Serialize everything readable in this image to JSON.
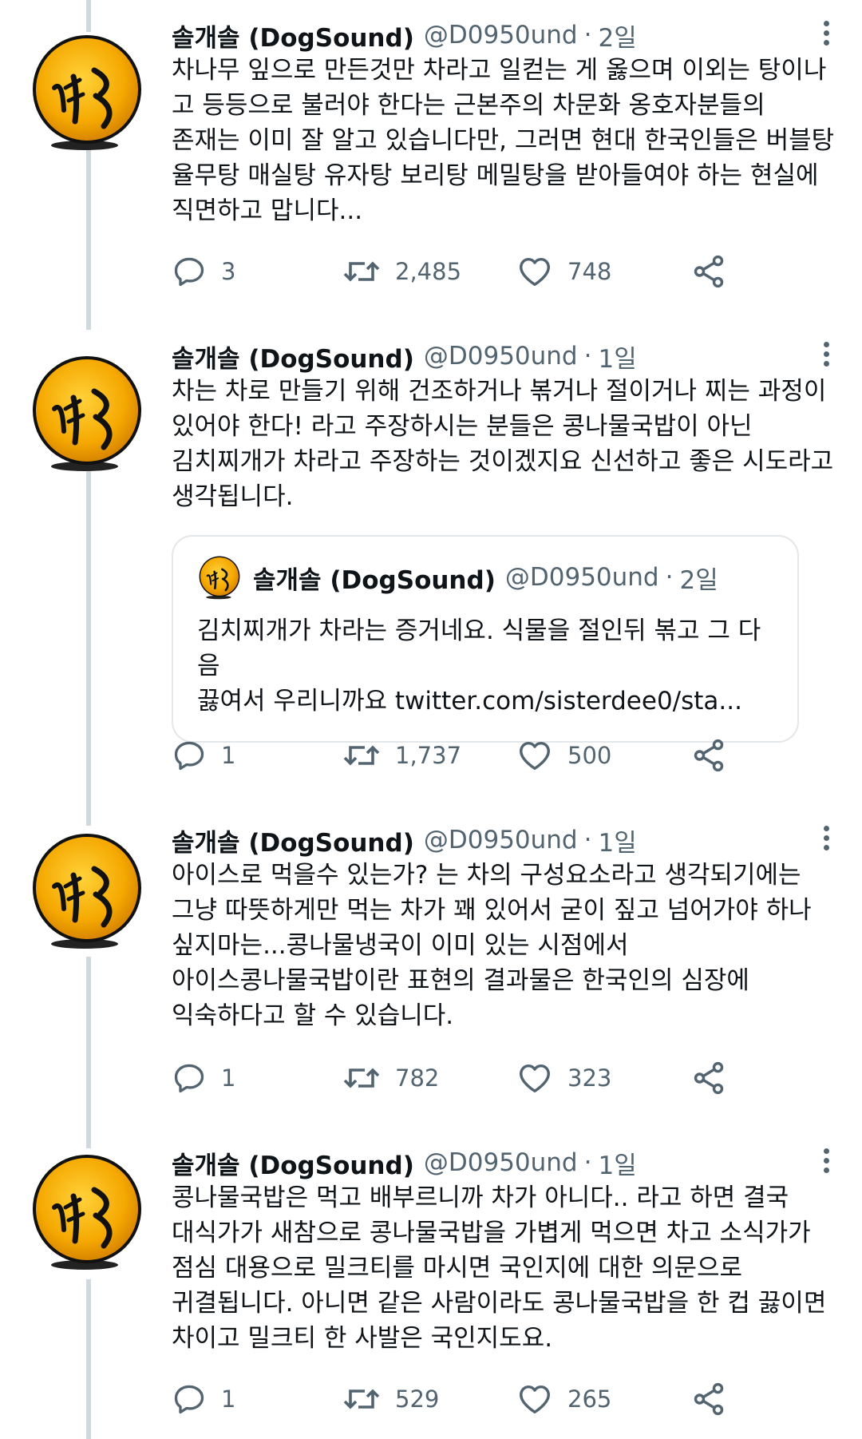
{
  "tweets": [
    {
      "name": "솔개솔 (DogSound)",
      "handle": "@D0950und",
      "time": "2일",
      "text": "차나무 잎으로 만든것만 차라고 일컫는 게 옳으며 이외는 탕이나\n고 등등으로 불러야 한다는 근본주의 차문화 옹호자분들의\n존재는 이미 잘 알고 있습니다만, 그러면 현대 한국인들은 버블탕\n율무탕 매실탕 유자탕 보리탕 메밀탕을 받아들여야 하는 현실에\n직면하고 맙니다...",
      "replies": "3",
      "retweets": "2,485",
      "likes": "748"
    },
    {
      "name": "솔개솔 (DogSound)",
      "handle": "@D0950und",
      "time": "1일",
      "text": "차는 차로 만들기 위해 건조하거나 볶거나 절이거나 찌는 과정이\n있어야 한다! 라고 주장하시는 분들은 콩나물국밥이 아닌\n김치찌개가 차라고 주장하는 것이겠지요 신선하고 좋은 시도라고\n생각됩니다.",
      "quote": {
        "name": "솔개솔 (DogSound)",
        "handle": "@D0950und",
        "time": "2일",
        "text": "김치찌개가 차라는 증거네요. 식물을 절인뒤 볶고 그 다음\n끓여서 우리니까요 twitter.com/sisterdee0/sta..."
      },
      "replies": "1",
      "retweets": "1,737",
      "likes": "500"
    },
    {
      "name": "솔개솔 (DogSound)",
      "handle": "@D0950und",
      "time": "1일",
      "text": "아이스로 먹을수 있는가? 는 차의 구성요소라고 생각되기에는\n그냥 따뜻하게만 먹는 차가 꽤 있어서 굳이 짚고 넘어가야 하나\n싶지마는...콩나물냉국이 이미 있는 시점에서\n아이스콩나물국밥이란 표현의 결과물은 한국인의 심장에\n익숙하다고 할 수 있습니다.",
      "replies": "1",
      "retweets": "782",
      "likes": "323"
    },
    {
      "name": "솔개솔 (DogSound)",
      "handle": "@D0950und",
      "time": "1일",
      "text": "콩나물국밥은 먹고 배부르니까 차가 아니다.. 라고 하면 결국\n대식가가 새참으로 콩나물국밥을 가볍게 먹으면 차고 소식가가\n점심 대용으로 밀크티를 마시면 국인지에 대한 의문으로\n귀결됩니다. 아니면 같은 사람이라도 콩나물국밥을 한 컵 끓이면\n차이고 밀크티 한 사발은 국인지도요.",
      "replies": "1",
      "retweets": "529",
      "likes": "265"
    }
  ],
  "separator": "·",
  "colors": {
    "text": "#0f1419",
    "secondary": "#536471",
    "thread_line": "#cfd9de",
    "avatar_fill": "#f5a800"
  }
}
